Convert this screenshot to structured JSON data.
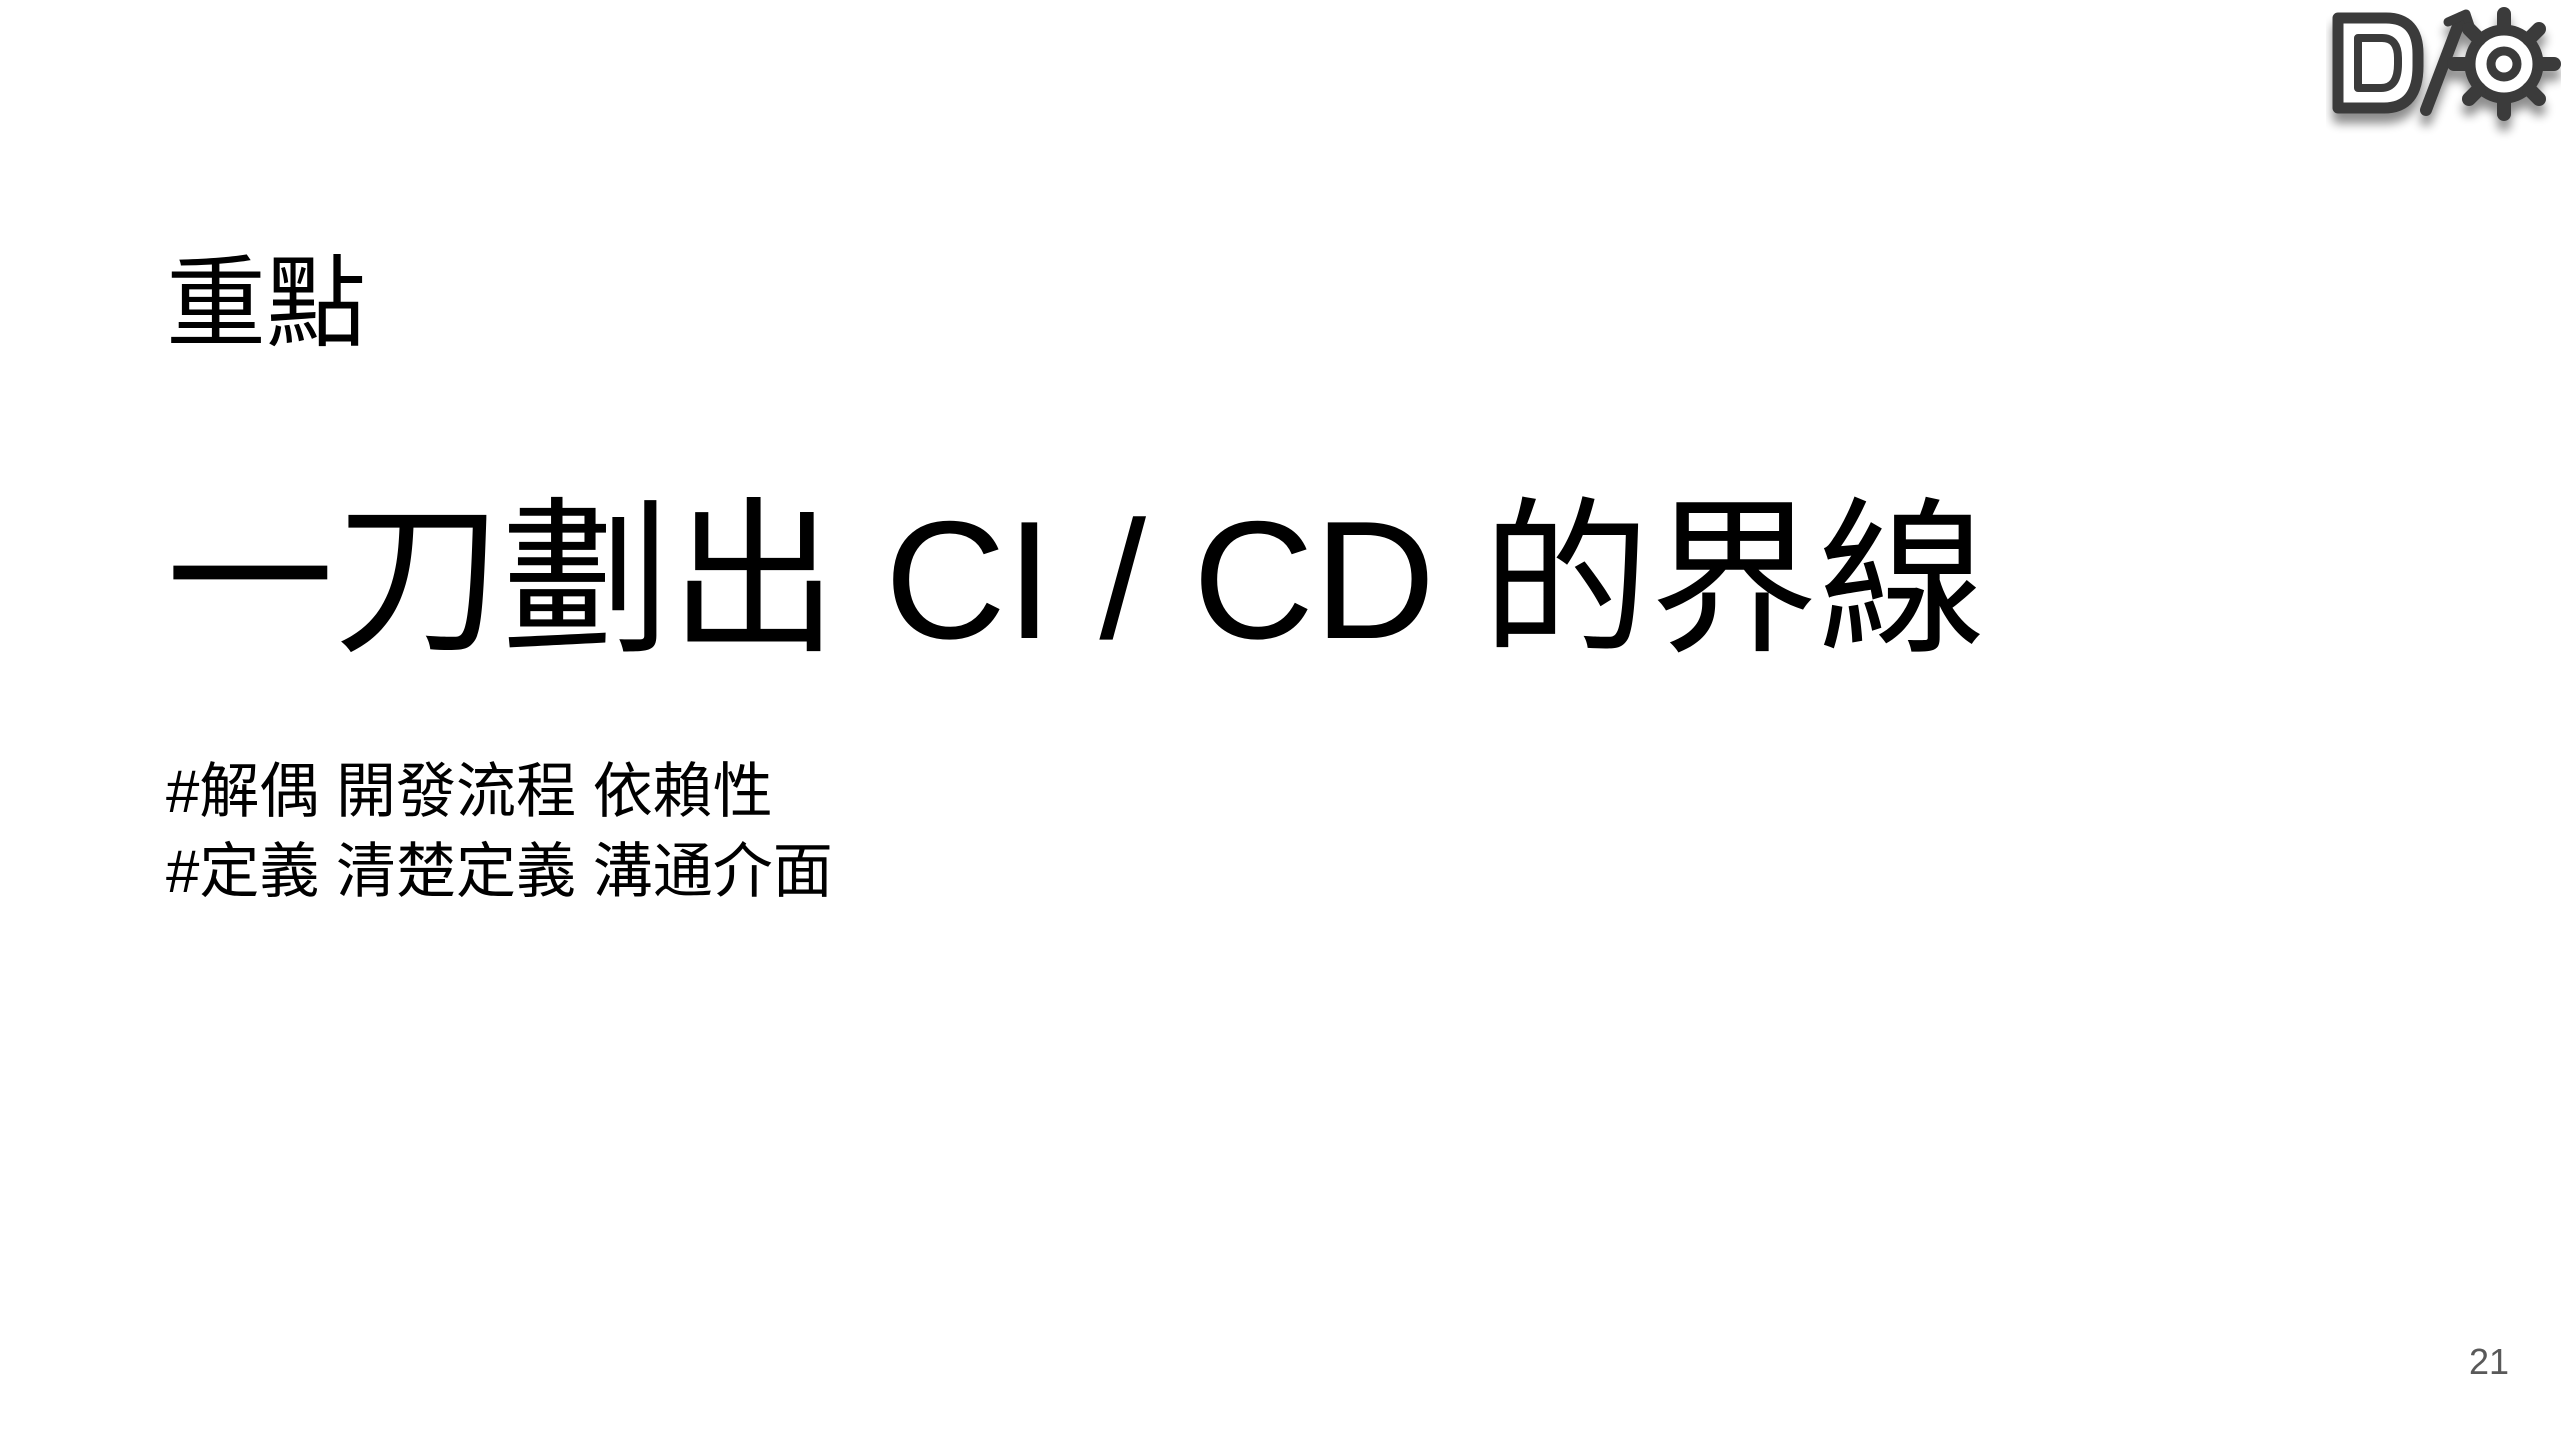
{
  "slide": {
    "kicker": "重點",
    "title": "一刀劃出 CI / CD 的界線",
    "tags": [
      "#解偶 開發流程 依賴性",
      "#定義 清楚定義 溝通介面"
    ],
    "page_number": "21"
  },
  "logo": {
    "icon": "d-slash-gear-logo",
    "text": "D/"
  },
  "colors": {
    "background": "#ffffff",
    "text": "#000000",
    "page_number": "#595959",
    "logo_stroke": "#3a3a3a"
  }
}
